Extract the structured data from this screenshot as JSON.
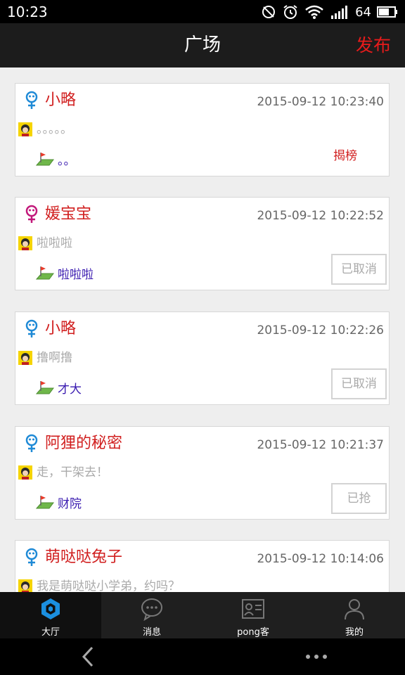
{
  "status_bar": {
    "time": "10:23",
    "battery": "64"
  },
  "header": {
    "title": "广场",
    "publish_label": "发布"
  },
  "feed": [
    {
      "gender": "male",
      "name": "小略",
      "time": "2015-09-12 10:23:40",
      "message": "。。。。。",
      "place": "。。",
      "action_label": "揭榜",
      "action_style": "text"
    },
    {
      "gender": "female",
      "name": "媛宝宝",
      "time": "2015-09-12 10:22:52",
      "message": "啦啦啦",
      "place": "啦啦啦",
      "action_label": "已取消",
      "action_style": "button"
    },
    {
      "gender": "male",
      "name": "小略",
      "time": "2015-09-12 10:22:26",
      "message": "撸啊撸",
      "place": "才大",
      "action_label": "已取消",
      "action_style": "button"
    },
    {
      "gender": "male",
      "name": "阿狸的秘密",
      "time": "2015-09-12 10:21:37",
      "message": "走，干架去！",
      "place": "财院",
      "action_label": "已抢",
      "action_style": "button"
    },
    {
      "gender": "male",
      "name": "萌哒哒兔子",
      "time": "2015-09-12 10:14:06",
      "message": "我是萌哒哒小学弟，约吗？",
      "place": "",
      "action_label": "",
      "action_style": "none"
    }
  ],
  "tabs": [
    {
      "label": "大厅",
      "icon": "hall-icon",
      "active": true
    },
    {
      "label": "消息",
      "icon": "message-icon",
      "active": false
    },
    {
      "label": "pong客",
      "icon": "contact-card-icon",
      "active": false
    },
    {
      "label": "我的",
      "icon": "profile-icon",
      "active": false
    }
  ],
  "colors": {
    "accent": "#e81b1b",
    "name": "#d11f1f",
    "place": "#3a1bb0",
    "male_icon": "#1f8ad6",
    "female_icon": "#c2187a"
  }
}
